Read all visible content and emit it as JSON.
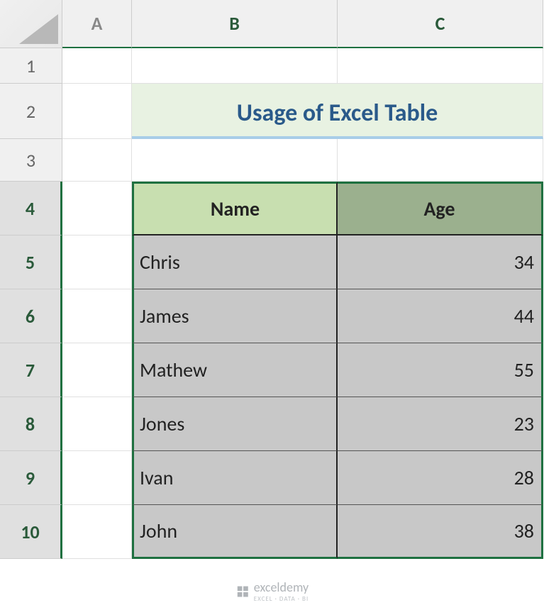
{
  "columns": [
    "A",
    "B",
    "C"
  ],
  "rows": [
    "1",
    "2",
    "3",
    "4",
    "5",
    "6",
    "7",
    "8",
    "9",
    "10"
  ],
  "title": "Usage of Excel Table",
  "table": {
    "headers": {
      "name": "Name",
      "age": "Age"
    },
    "data": [
      {
        "name": "Chris",
        "age": "34"
      },
      {
        "name": "James",
        "age": "44"
      },
      {
        "name": "Mathew",
        "age": "55"
      },
      {
        "name": "Jones",
        "age": "23"
      },
      {
        "name": "Ivan",
        "age": "28"
      },
      {
        "name": "John",
        "age": "38"
      }
    ]
  },
  "watermark": {
    "name": "exceldemy",
    "tagline": "EXCEL · DATA · BI"
  },
  "chart_data": {
    "type": "table",
    "title": "Usage of Excel Table",
    "columns": [
      "Name",
      "Age"
    ],
    "rows": [
      [
        "Chris",
        34
      ],
      [
        "James",
        44
      ],
      [
        "Mathew",
        55
      ],
      [
        "Jones",
        23
      ],
      [
        "Ivan",
        28
      ],
      [
        "John",
        38
      ]
    ]
  }
}
